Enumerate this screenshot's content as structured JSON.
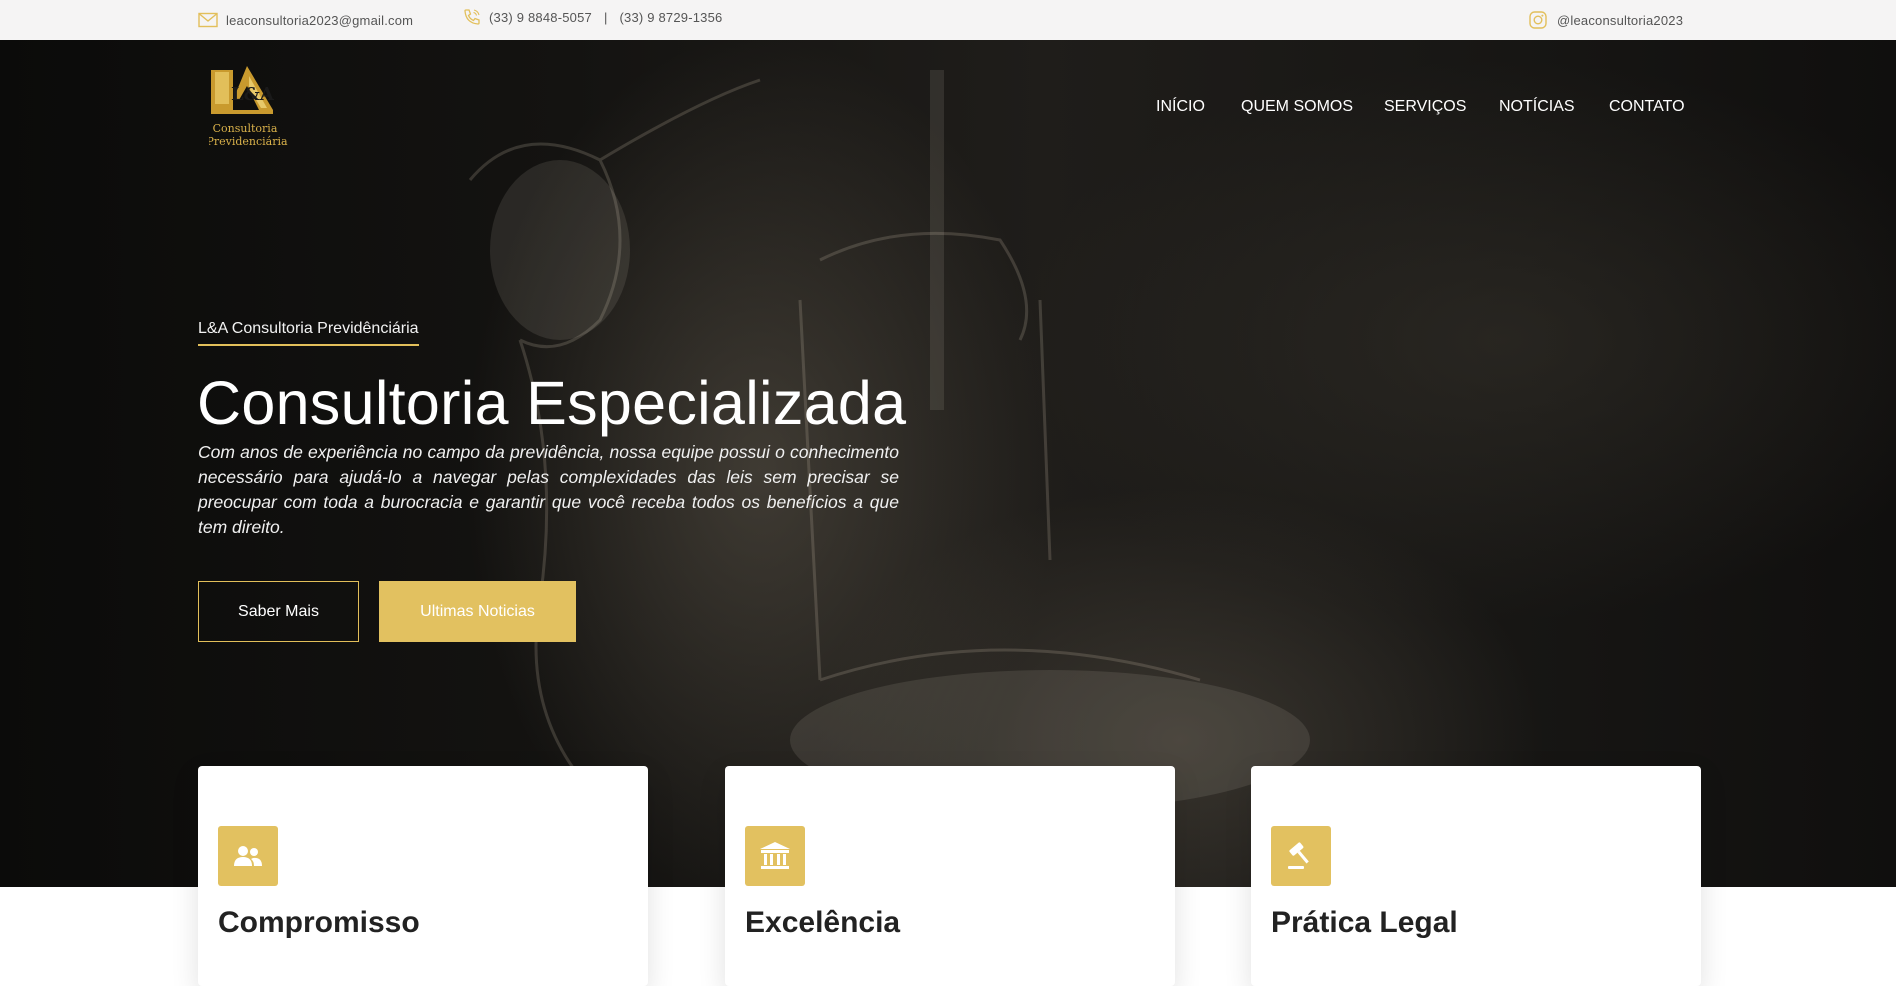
{
  "topbar": {
    "email": "leaconsultoria2023@gmail.com",
    "phone_1": "(33) 9 8848-5057",
    "phone_separator": "|",
    "phone_2": "(33) 9 8729-1356",
    "instagram": "@leaconsultoria2023"
  },
  "logo": {
    "mark": "L&A",
    "line_1": "Consultoria",
    "line_2": "Previdenciária"
  },
  "nav": {
    "items": [
      "INÍCIO",
      "QUEM SOMOS",
      "SERVIÇOS",
      "NOTÍCIAS",
      "CONTATO"
    ]
  },
  "hero": {
    "kicker": "L&A Consultoria Previdênciária",
    "title": "Consultoria Especializada",
    "description": "Com anos de experiência no campo da previdência, nossa equipe possui o conhecimento necessário para ajudá-lo a navegar pelas complexidades das leis sem precisar se preocupar com toda a burocracia e garantir que você receba todos os benefícios a que tem direito.",
    "button_primary": "Saber Mais",
    "button_secondary": "Ultimas Noticias"
  },
  "features": [
    {
      "title": "Compromisso",
      "icon": "users-icon"
    },
    {
      "title": "Excelência",
      "icon": "bank-icon"
    },
    {
      "title": "Prática Legal",
      "icon": "gavel-icon"
    }
  ],
  "colors": {
    "accent": "#e2c160",
    "topbar_bg": "#f5f4f4",
    "hero_bg": "#141311",
    "text_light": "#ffffff"
  }
}
